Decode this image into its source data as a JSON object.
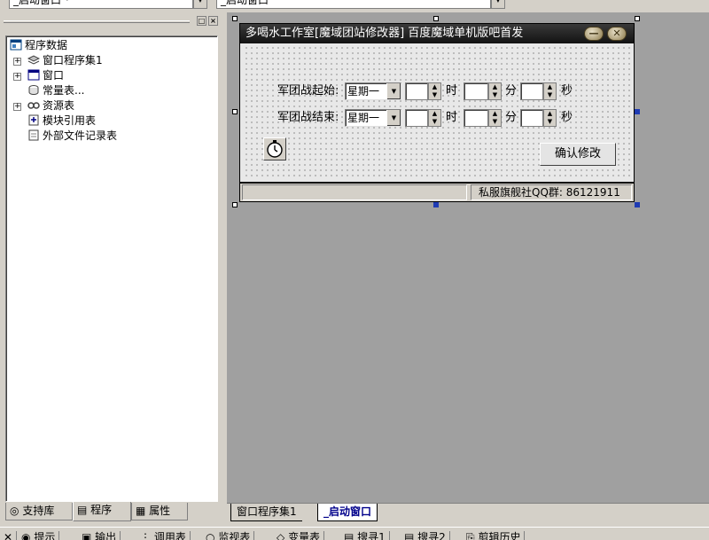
{
  "top": {
    "left_combo": "_启动窗口 *",
    "right_combo": "_启动窗口"
  },
  "left_panel": {
    "tree": [
      {
        "label": "程序数据",
        "icon": "program-data-icon"
      },
      {
        "label": "窗口程序集1",
        "icon": "assembly-icon"
      },
      {
        "label": "窗口",
        "icon": "window-icon"
      },
      {
        "label": "常量表...",
        "icon": "constant-table-icon"
      },
      {
        "label": "资源表",
        "icon": "resource-icon"
      },
      {
        "label": "模块引用表",
        "icon": "module-ref-icon"
      },
      {
        "label": "外部文件记录表",
        "icon": "external-file-icon"
      }
    ],
    "tabs": [
      "支持库",
      "程序",
      "属性"
    ]
  },
  "form": {
    "title": "多喝水工作室[魔域团站修改器] 百度魔域单机版吧首发",
    "row1_label": "军团战起始:",
    "row2_label": "军团战结束:",
    "weekday_value": "星期一",
    "hour_unit": "时",
    "minute_unit": "分",
    "second_unit": "秒",
    "confirm_button": "确认修改",
    "status_left": "",
    "status_right": "私服旗舰社QQ群: 86121911"
  },
  "designer_tabs": [
    "窗口程序集1",
    "_启动窗口"
  ],
  "bottom_tabs": [
    "提示",
    "输出",
    "调用表",
    "监视表",
    "变量表",
    "搜寻1",
    "搜寻2",
    "剪辑历史"
  ]
}
